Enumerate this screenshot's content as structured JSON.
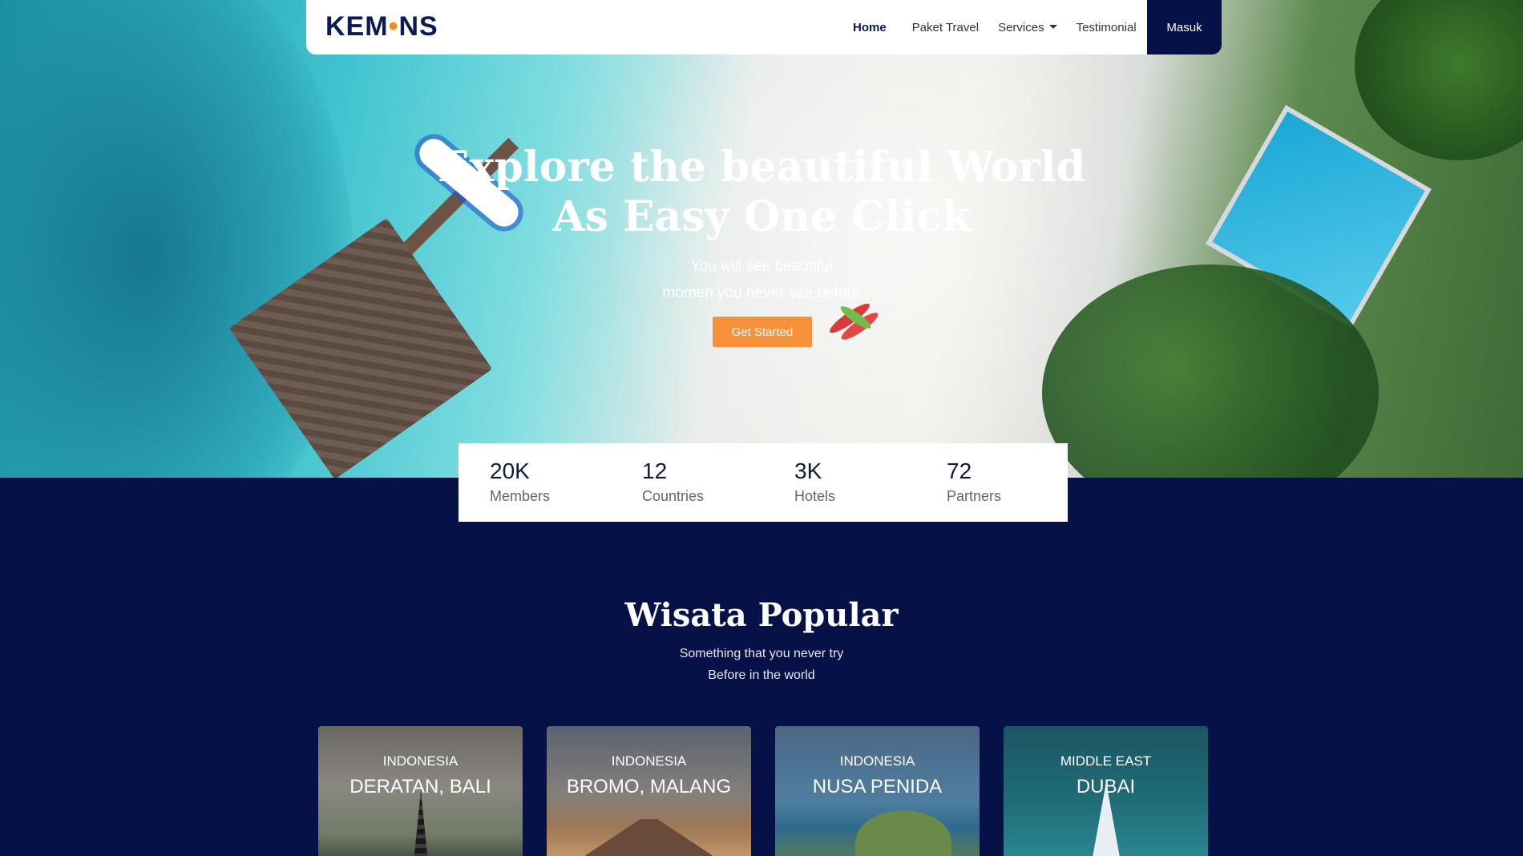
{
  "brand": {
    "logo_text_a": "KEM",
    "logo_text_dot": "•",
    "logo_text_b": "NS"
  },
  "nav": {
    "items": [
      "Home",
      "Paket Travel",
      "Services",
      "Testimonial"
    ],
    "login_label": "Masuk"
  },
  "hero": {
    "title_line1": "Explore the beautiful World",
    "title_line2": "As Easy One Click",
    "subtitle_line1": "You will see beautiful",
    "subtitle_line2": "momen you never see before",
    "cta_label": "Get Started"
  },
  "stats": [
    {
      "value": "20K",
      "label": "Members"
    },
    {
      "value": "12",
      "label": "Countries"
    },
    {
      "value": "3K",
      "label": "Hotels"
    },
    {
      "value": "72",
      "label": "Partners"
    }
  ],
  "popular": {
    "title": "Wisata Popular",
    "subtitle_line1": "Something that you never try",
    "subtitle_line2": "Before in the world",
    "cards": [
      {
        "region": "INDONESIA",
        "name": "DERATAN, BALI"
      },
      {
        "region": "INDONESIA",
        "name": "BROMO, MALANG"
      },
      {
        "region": "INDONESIA",
        "name": "NUSA PENIDA"
      },
      {
        "region": "MIDDLE EAST",
        "name": "DUBAI"
      }
    ]
  },
  "colors": {
    "navy": "#061247",
    "accent": "#f7913a",
    "white": "#ffffff"
  }
}
